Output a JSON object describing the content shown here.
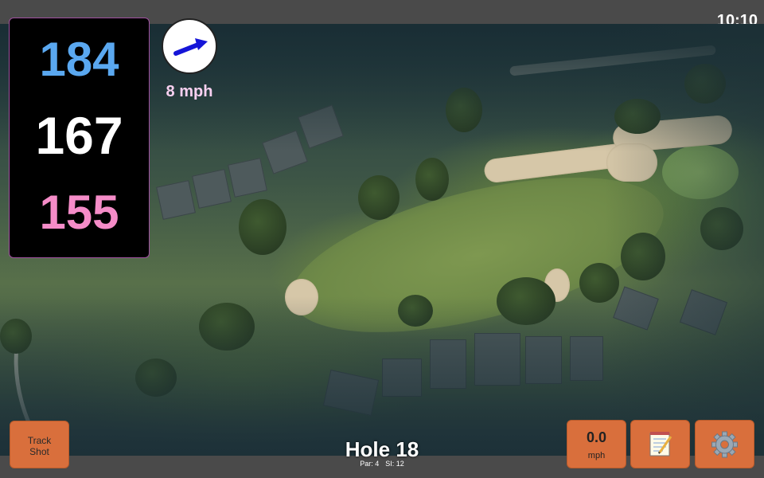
{
  "status": {
    "time": "10:10"
  },
  "distances": {
    "back": "184",
    "middle": "167",
    "front": "155"
  },
  "wind": {
    "speed_label": "8 mph",
    "direction_icon": "wind-arrow-icon"
  },
  "buttons": {
    "track_shot_line1": "Track",
    "track_shot_line2": "Shot",
    "speed_value": "0.0",
    "speed_unit": "mph",
    "notes_icon": "notepad-icon",
    "settings_icon": "gear-icon"
  },
  "hole": {
    "title": "Hole 18",
    "par": "Par: 4",
    "si": "SI: 12"
  },
  "colors": {
    "back": "#5aa8f0",
    "middle": "#ffffff",
    "front": "#f58cc8",
    "button": "#d96f3c",
    "wind_text": "#f8d0f0"
  }
}
